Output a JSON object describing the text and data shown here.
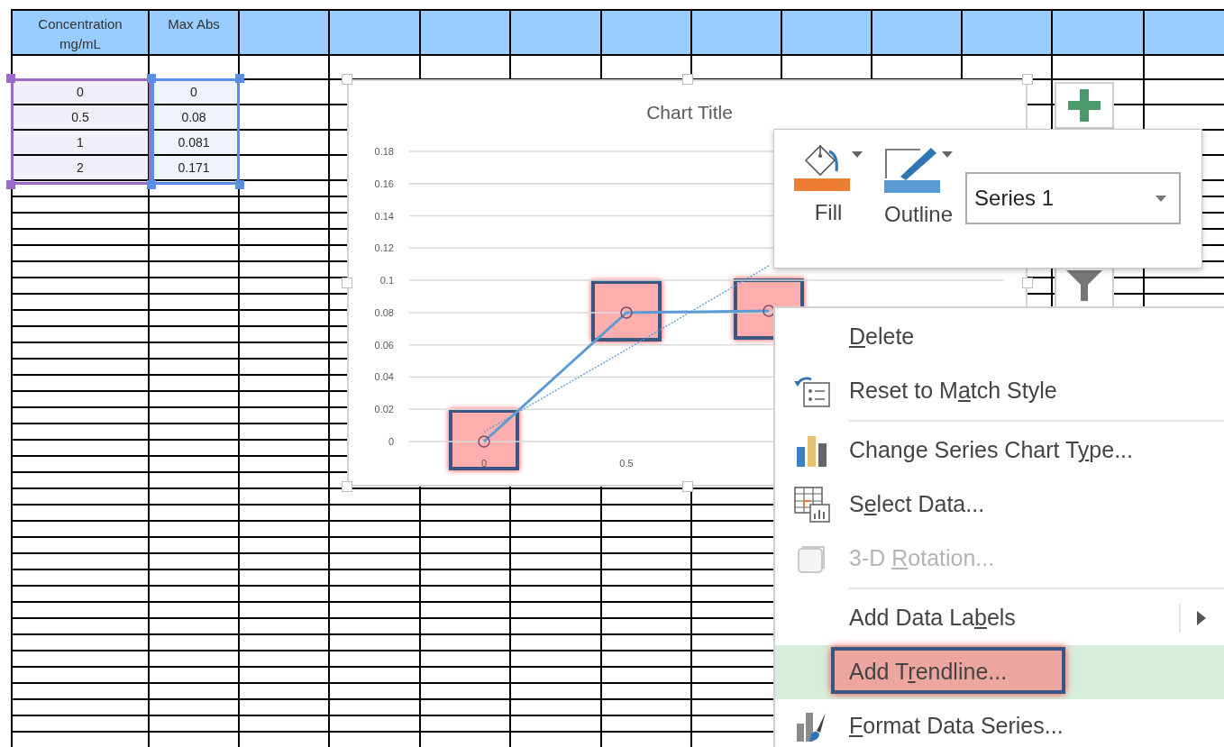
{
  "sheet": {
    "columns": [
      {
        "header": "Concentration mg/mL",
        "color": "#9b6bc7"
      },
      {
        "header": "Max Abs",
        "color": "#5b8ee6"
      }
    ],
    "rows": [
      [
        "0",
        "0"
      ],
      [
        "0.5",
        "0.08"
      ],
      [
        "1",
        "0.081"
      ],
      [
        "2",
        "0.171"
      ]
    ]
  },
  "chart": {
    "chart_data": {
      "type": "line",
      "title": "Chart Title",
      "categories": [
        "0",
        "0.5",
        null,
        null
      ],
      "series": [
        {
          "name": "Series 1",
          "color": "#5b9bd5",
          "marker": "circle",
          "values": [
            0,
            0.08,
            0.081,
            null
          ]
        },
        {
          "color": "#5b9bd5",
          "line_style": "dotted",
          "values": [
            0.006,
            0.057,
            0.109,
            null
          ]
        }
      ],
      "ylim": [
        0,
        0.18
      ],
      "yticks": [
        0,
        0.02,
        0.04,
        0.06,
        0.08,
        0.1,
        0.12,
        0.14,
        0.16,
        0.18
      ],
      "grid": true
    }
  },
  "mini_toolbar": {
    "buttons": [
      {
        "kind": "fill",
        "label": "Fill",
        "color": "#ed7d31"
      },
      {
        "kind": "outline",
        "label": "Outline",
        "color": "#5b9bd5"
      }
    ]
  },
  "context_menu": {
    "items": [
      {
        "key": "D",
        "after": "elete",
        "disabled": false,
        "selected": false,
        "has_submenu": false,
        "callout": false,
        "separator_after": false
      },
      {
        "before": "Reset to M",
        "key": "a",
        "after": "tch Style",
        "disabled": false,
        "selected": false,
        "has_submenu": false,
        "callout": false,
        "separator_after": true
      },
      {
        "before": "Change Series Chart T",
        "key": "y",
        "after": "pe...",
        "disabled": false,
        "selected": false,
        "has_submenu": false,
        "callout": false,
        "separator_after": false
      },
      {
        "before": "S",
        "key": "e",
        "after": "lect Data...",
        "disabled": false,
        "selected": false,
        "has_submenu": false,
        "callout": false,
        "separator_after": false
      },
      {
        "before": "3-D ",
        "key": "R",
        "after": "otation...",
        "disabled": true,
        "selected": false,
        "has_submenu": false,
        "callout": false,
        "separator_after": true
      },
      {
        "before": "Add Data La",
        "key": "b",
        "after": "els",
        "disabled": false,
        "selected": false,
        "has_submenu": true,
        "callout": false,
        "separator_after": false
      },
      {
        "before": "Add T",
        "key": "r",
        "after": "endline...",
        "disabled": false,
        "selected": true,
        "has_submenu": false,
        "callout": true,
        "separator_after": false
      },
      {
        "key": "F",
        "after": "ormat Data Series...",
        "disabled": false,
        "selected": false,
        "has_submenu": false,
        "callout": false,
        "separator_after": false
      }
    ]
  }
}
